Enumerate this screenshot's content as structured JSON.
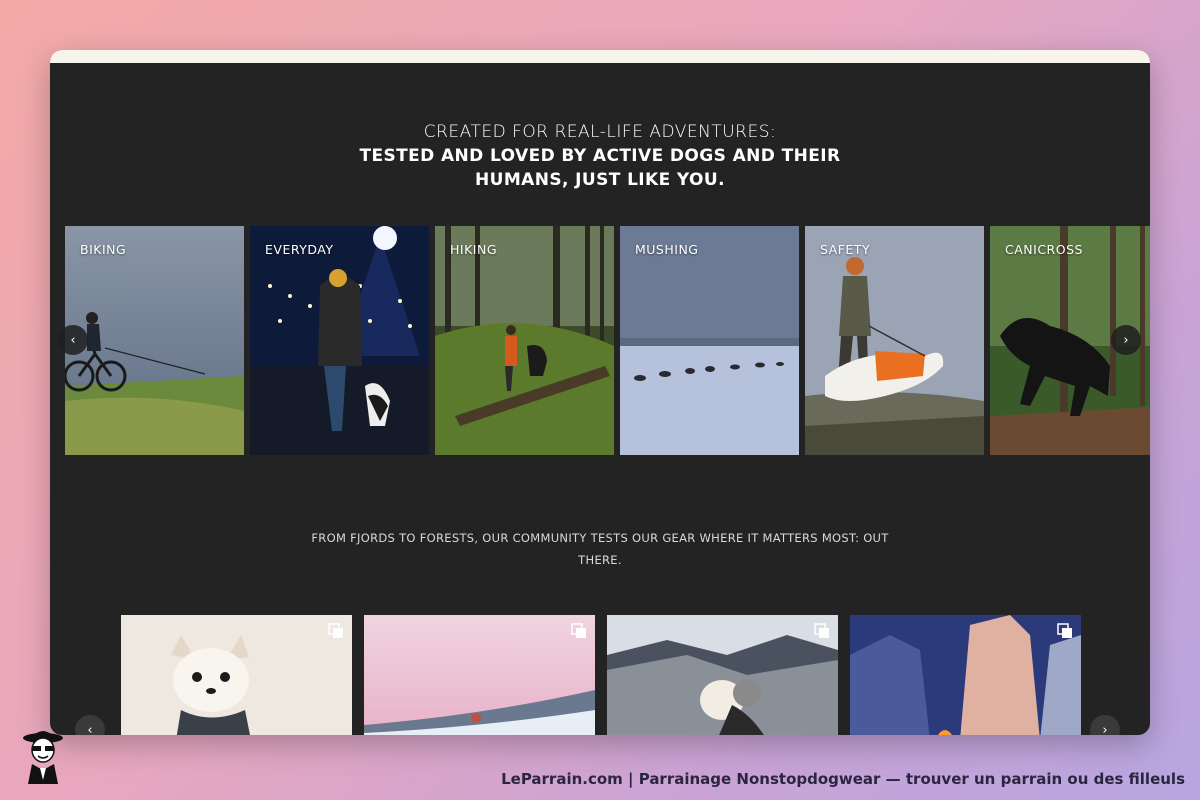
{
  "headline": {
    "line1": "CREATED FOR REAL-LIFE ADVENTURES:",
    "line2": "TESTED AND LOVED BY ACTIVE DOGS AND THEIR HUMANS, JUST LIKE YOU."
  },
  "categories": [
    {
      "label": "BIKING"
    },
    {
      "label": "EVERYDAY"
    },
    {
      "label": "HIKING"
    },
    {
      "label": "MUSHING"
    },
    {
      "label": "SAFETY"
    },
    {
      "label": "CANICROSS"
    }
  ],
  "carousel": {
    "prev_icon": "chevron-left-icon",
    "next_icon": "chevron-right-icon",
    "prev_glyph": "‹",
    "next_glyph": "›"
  },
  "tagline": "FROM FJORDS TO FORESTS, OUR COMMUNITY TESTS OUR GEAR WHERE IT MATTERS MOST: OUT THERE.",
  "ugc": {
    "multi_icon": "gallery-stack-icon"
  },
  "footer": {
    "text": "LeParrain.com | Parrainage Nonstopdogwear — trouver un parrain ou des filleuls"
  },
  "colors": {
    "panel_bg": "#232323",
    "topbar": "#f7f4ec",
    "text": "#ffffff"
  }
}
